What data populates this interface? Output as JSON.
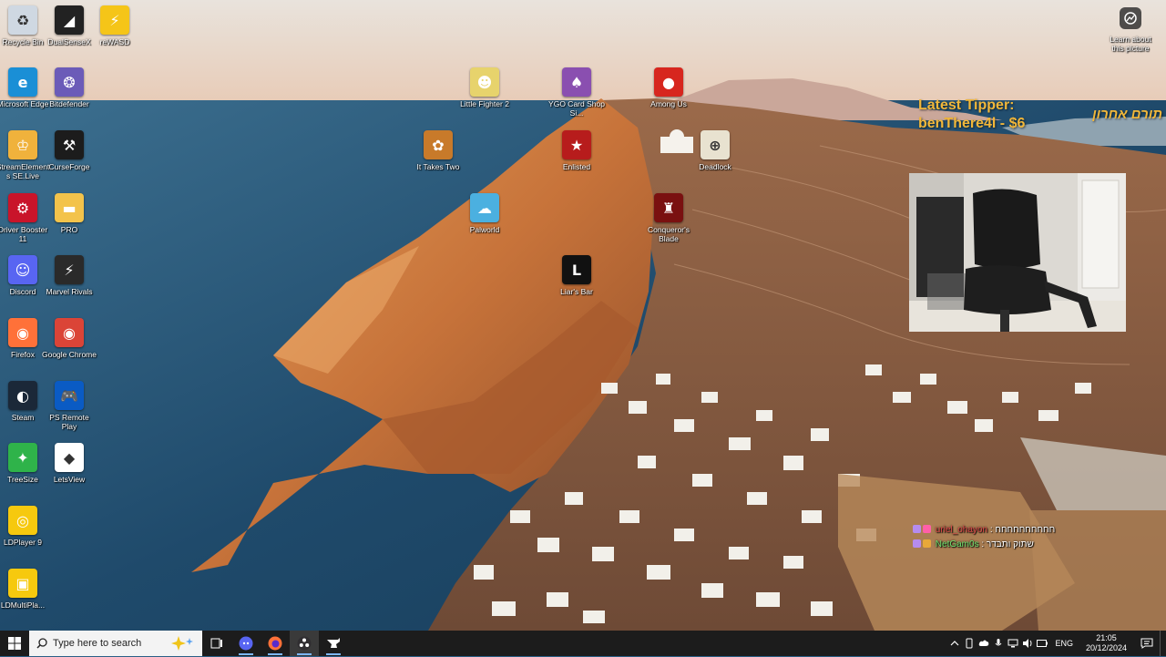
{
  "desktop": {
    "icons_col1": [
      {
        "label": "Recycle Bin",
        "icon": "recycle-bin-icon",
        "color": "#cfd8e2",
        "glyph": "♻"
      },
      {
        "label": "Microsoft Edge",
        "icon": "edge-icon",
        "color": "#1a8fd6",
        "glyph": "e"
      },
      {
        "label": "StreamElements SE.Live",
        "icon": "se-live-icon",
        "color": "#f0b23c",
        "glyph": "♔"
      },
      {
        "label": "Driver Booster 11",
        "icon": "driver-booster-icon",
        "color": "#c9142a",
        "glyph": "⚙"
      },
      {
        "label": "Discord",
        "icon": "discord-icon",
        "color": "#5865f2",
        "glyph": "☺"
      },
      {
        "label": "Firefox",
        "icon": "firefox-icon",
        "color": "#ff7139",
        "glyph": "◉"
      },
      {
        "label": "Steam",
        "icon": "steam-icon",
        "color": "#1b2838",
        "glyph": "◐"
      },
      {
        "label": "TreeSize",
        "icon": "treesize-icon",
        "color": "#2fb34a",
        "glyph": "✦"
      },
      {
        "label": "LDPlayer 9",
        "icon": "ldplayer-icon",
        "color": "#f6c90e",
        "glyph": "◎"
      },
      {
        "label": "LDMultiPla...",
        "icon": "ldmultiplayer-icon",
        "color": "#f6c90e",
        "glyph": "▣"
      }
    ],
    "icons_col2": [
      {
        "label": "DualSenseX",
        "icon": "dualsensex-icon",
        "color": "#222222",
        "glyph": "◢"
      },
      {
        "label": "Bitdefender",
        "icon": "bitdefender-icon",
        "color": "#6b5bb8",
        "glyph": "❂"
      },
      {
        "label": "CurseForge",
        "icon": "curseforge-icon",
        "color": "#1c1c1c",
        "glyph": "⚒"
      },
      {
        "label": "PRO",
        "icon": "folder-icon",
        "color": "#f3c34b",
        "glyph": "▬"
      },
      {
        "label": "Marvel Rivals",
        "icon": "marvel-rivals-icon",
        "color": "#2a2a2a",
        "glyph": "⚡"
      },
      {
        "label": "Google Chrome",
        "icon": "chrome-icon",
        "color": "#db4437",
        "glyph": "◉"
      },
      {
        "label": "PS Remote Play",
        "icon": "ps-remote-play-icon",
        "color": "#0a5bc4",
        "glyph": "🎮"
      },
      {
        "label": "LetsView",
        "icon": "letsview-icon",
        "color": "#ffffff",
        "glyph": "◆"
      }
    ],
    "icons_col3": [
      {
        "label": "reWASD",
        "icon": "rewasd-icon",
        "color": "#f5c518",
        "glyph": "⚡"
      }
    ],
    "icons_scattered": [
      {
        "label": "Little Fighter 2",
        "icon": "little-fighter-icon",
        "color": "#e7d36c",
        "glyph": "☻"
      },
      {
        "label": "It Takes Two",
        "icon": "it-takes-two-icon",
        "color": "#c87a2a",
        "glyph": "✿"
      },
      {
        "label": "Palworld",
        "icon": "palworld-icon",
        "color": "#4bb0e0",
        "glyph": "☁"
      },
      {
        "label": "YGO Card Shop Si...",
        "icon": "ygo-card-shop-icon",
        "color": "#8a4fb0",
        "glyph": "♠"
      },
      {
        "label": "Enlisted",
        "icon": "enlisted-icon",
        "color": "#b71c1c",
        "glyph": "★"
      },
      {
        "label": "Liar's Bar",
        "icon": "liars-bar-icon",
        "color": "#111111",
        "glyph": "L"
      },
      {
        "label": "Among Us",
        "icon": "among-us-icon",
        "color": "#d7261e",
        "glyph": "●"
      },
      {
        "label": "Deadlock",
        "icon": "deadlock-icon",
        "color": "#e8e2d0",
        "glyph": "⊕"
      },
      {
        "label": "Conqueror's Blade",
        "icon": "conquerors-blade-icon",
        "color": "#7a1010",
        "glyph": "♜"
      }
    ]
  },
  "learn_picture": {
    "label": "Learn about this picture"
  },
  "tipper": {
    "title": "Latest Tipper:",
    "value": "benThere4l - $6",
    "hebrew": "תורם אחרון"
  },
  "chat": [
    {
      "user": "uriel_ohayon",
      "message": "חחחחחחחחחח",
      "user_color": "#e24a4a"
    },
    {
      "user": "NetGam0s",
      "message": "שתוק ותבדר",
      "user_color": "#6fe36f"
    }
  ],
  "taskbar": {
    "search_placeholder": "Type here to search",
    "apps": [
      {
        "name": "task-view-icon"
      },
      {
        "name": "discord-icon"
      },
      {
        "name": "firefox-icon"
      },
      {
        "name": "obs-icon"
      },
      {
        "name": "curseforge-icon"
      }
    ],
    "language": "ENG",
    "time": "21:05",
    "date": "20/12/2024"
  }
}
